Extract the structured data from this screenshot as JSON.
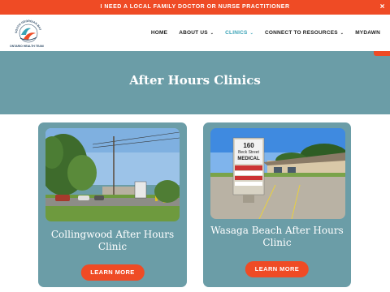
{
  "banner": {
    "text": "I NEED A LOCAL FAMILY DOCTOR OR NURSE PRACTITIONER",
    "close_icon": "×"
  },
  "logo": {
    "ring_text": "SOUTH GEORGIAN BAY",
    "subtitle": "ONTARIO HEALTH TEAM"
  },
  "nav": {
    "items": [
      {
        "label": "HOME",
        "dropdown": false,
        "active": false
      },
      {
        "label": "ABOUT US",
        "dropdown": true,
        "active": false
      },
      {
        "label": "CLINICS",
        "dropdown": true,
        "active": true
      },
      {
        "label": "CONNECT TO RESOURCES",
        "dropdown": true,
        "active": false
      },
      {
        "label": "MYDAWN",
        "dropdown": false,
        "active": false
      }
    ]
  },
  "hero": {
    "title": "After Hours Clinics"
  },
  "cards": [
    {
      "title": "Collingwood After Hours Clinic",
      "button": "LEARN MORE"
    },
    {
      "title": "Wasaga Beach After Hours Clinic",
      "button": "LEARN MORE",
      "sign_text": [
        "160",
        "Beck Street",
        "MEDICAL"
      ]
    }
  ],
  "colors": {
    "accent": "#ef4b25",
    "teal": "#6b9da7",
    "active_nav": "#3aa3b6"
  }
}
